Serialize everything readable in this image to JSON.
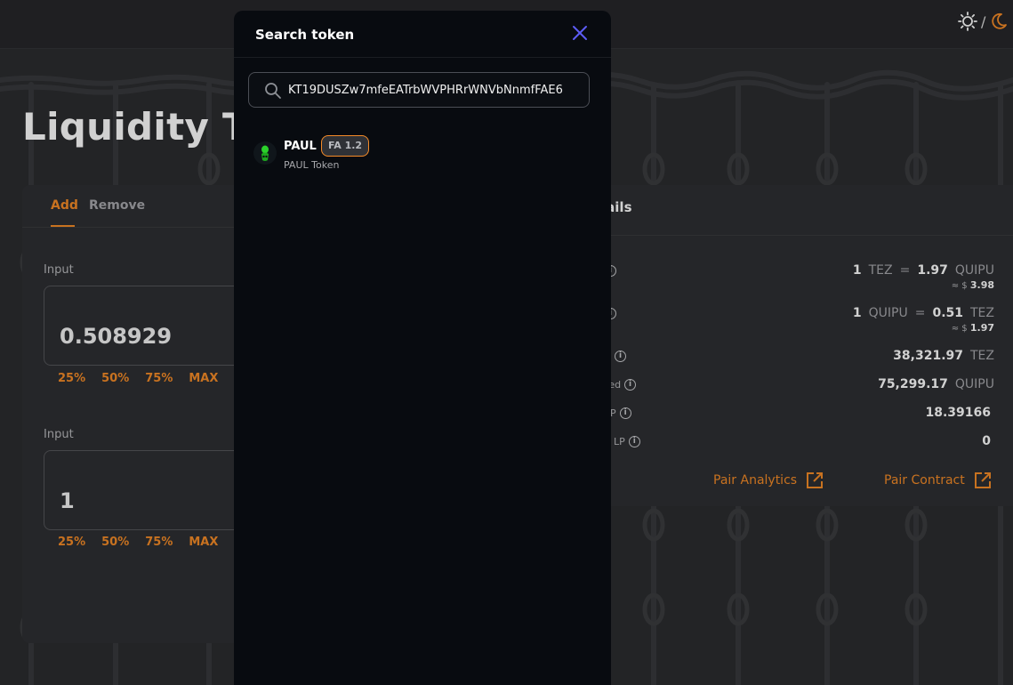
{
  "page": {
    "title": "Liquidity TE"
  },
  "theme_toggle": {
    "separator": "/",
    "light_icon": "sun-icon",
    "dark_icon": "moon-icon"
  },
  "liquidity_form": {
    "tabs": [
      {
        "label": "Add",
        "active": true
      },
      {
        "label": "Remove",
        "active": false
      }
    ],
    "inputs": [
      {
        "label": "Input",
        "value": "0.508929"
      },
      {
        "label": "Input",
        "value": "1"
      }
    ],
    "percent_buttons": [
      "25%",
      "50%",
      "75%",
      "MAX"
    ]
  },
  "details": {
    "heading": "tails",
    "rows": [
      {
        "label_fragment": "",
        "amount": "1",
        "from": "TEZ",
        "eq": "=",
        "rate": "1.97",
        "to": "QUIPU",
        "usd_prefix": "≈ $",
        "usd": "3.98"
      },
      {
        "label_fragment": "",
        "amount": "1",
        "from": "QUIPU",
        "eq": "=",
        "rate": "0.51",
        "to": "TEZ",
        "usd_prefix": "≈ $",
        "usd": "1.97"
      },
      {
        "label_fragment": "",
        "value": "38,321.97",
        "unit": "TEZ"
      },
      {
        "label_fragment": "ted",
        "value": "75,299.17",
        "unit": "QUIPU"
      },
      {
        "label_fragment": "P",
        "value": "18.39166",
        "unit": ""
      },
      {
        "label_fragment": "LP",
        "value": "0",
        "unit": ""
      }
    ],
    "links": [
      {
        "label": "Pair Analytics",
        "icon": "external-link-icon"
      },
      {
        "label": "Pair Contract",
        "icon": "external-link-icon"
      }
    ]
  },
  "search_modal": {
    "title": "Search token",
    "close_icon": "close-icon",
    "search": {
      "value": "KT19DUSZw7mfeEATrbWVPHRrWNVbNnmfFAE6",
      "icon": "search-icon"
    },
    "results": [
      {
        "symbol": "PAUL",
        "badge": "FA 1.2",
        "name": "PAUL Token",
        "avatar": "paul-token-avatar"
      }
    ]
  },
  "colors": {
    "accent": "#f58b28",
    "modal_bg": "#080b10",
    "page_bg": "#2b2c2f",
    "close": "#5c5cf5"
  }
}
